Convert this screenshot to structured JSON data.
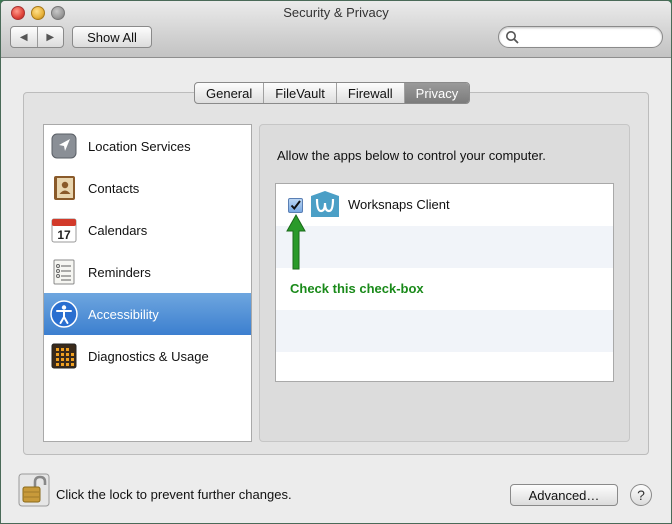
{
  "window": {
    "title": "Security & Privacy",
    "nav_back": "◀",
    "nav_forward": "▶",
    "show_all_label": "Show All",
    "search_placeholder": ""
  },
  "tabs": [
    {
      "label": "General",
      "active": false
    },
    {
      "label": "FileVault",
      "active": false
    },
    {
      "label": "Firewall",
      "active": false
    },
    {
      "label": "Privacy",
      "active": true
    }
  ],
  "sidebar": {
    "items": [
      {
        "label": "Location Services",
        "icon": "location-arrow-icon",
        "selected": false
      },
      {
        "label": "Contacts",
        "icon": "contacts-book-icon",
        "selected": false
      },
      {
        "label": "Calendars",
        "icon": "calendar-icon",
        "selected": false
      },
      {
        "label": "Reminders",
        "icon": "reminders-list-icon",
        "selected": false
      },
      {
        "label": "Accessibility",
        "icon": "accessibility-icon",
        "selected": true
      },
      {
        "label": "Diagnostics & Usage",
        "icon": "diagnostics-icon",
        "selected": false
      }
    ],
    "calendar_day": "17"
  },
  "privacy_pane": {
    "description": "Allow the apps below to control your computer.",
    "apps": [
      {
        "name": "Worksnaps Client",
        "checked": true,
        "icon": "worksnaps-icon"
      }
    ],
    "annotation": "Check this check-box"
  },
  "footer": {
    "lock_text": "Click the lock to prevent further changes.",
    "advanced_label": "Advanced…",
    "help_label": "?"
  },
  "colors": {
    "selection": "#3c7fcf",
    "annotation_green": "#1a8a1a",
    "worksnaps_blue": "#4b9fc6"
  }
}
